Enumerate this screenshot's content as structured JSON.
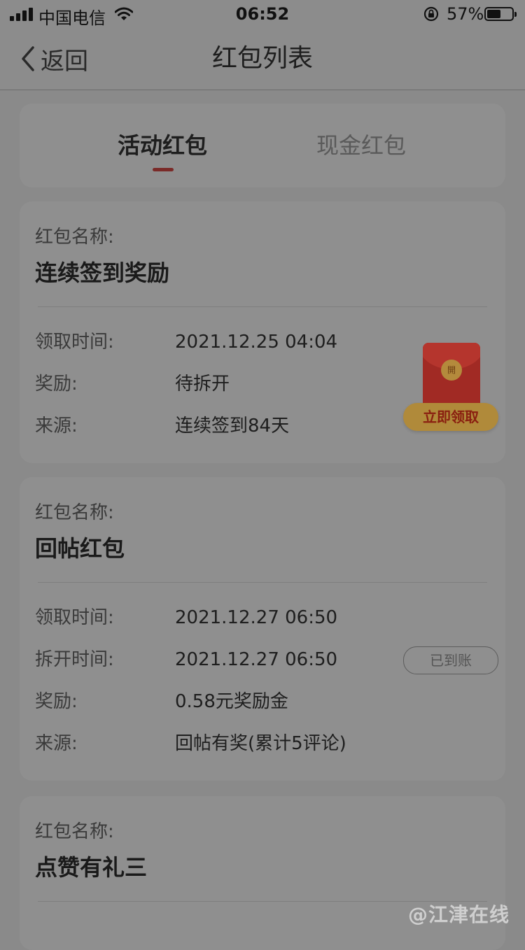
{
  "status_bar": {
    "carrier": "中国电信",
    "time": "06:52",
    "battery_percent": "57%",
    "battery_level": 0.57
  },
  "nav": {
    "back_label": "返回",
    "title": "红包列表"
  },
  "tabs": [
    {
      "label": "活动红包",
      "active": true
    },
    {
      "label": "现金红包",
      "active": false
    }
  ],
  "packets": [
    {
      "name_label": "红包名称:",
      "name": "连续签到奖励",
      "rows": [
        {
          "label": "领取时间:",
          "value": "2021.12.25 04:04"
        },
        {
          "label": "奖励:",
          "value": "待拆开"
        },
        {
          "label": "来源:",
          "value": "连续签到84天"
        }
      ],
      "seal_text": "開",
      "action_label": "立即领取"
    },
    {
      "name_label": "红包名称:",
      "name": "回帖红包",
      "rows": [
        {
          "label": "领取时间:",
          "value": "2021.12.27 06:50"
        },
        {
          "label": "拆开时间:",
          "value": "2021.12.27 06:50"
        },
        {
          "label": "奖励:",
          "value": "0.58元奖励金"
        },
        {
          "label": "来源:",
          "value": "回帖有奖(累计5评论)"
        }
      ],
      "status_label": "已到账"
    },
    {
      "name_label": "红包名称:",
      "name": "点赞有礼三"
    }
  ],
  "watermark": "@江津在线",
  "colors": {
    "tab_indicator": "#7a2a28",
    "packet_red": "#a12a24",
    "claim_button": "#b08a3a"
  }
}
